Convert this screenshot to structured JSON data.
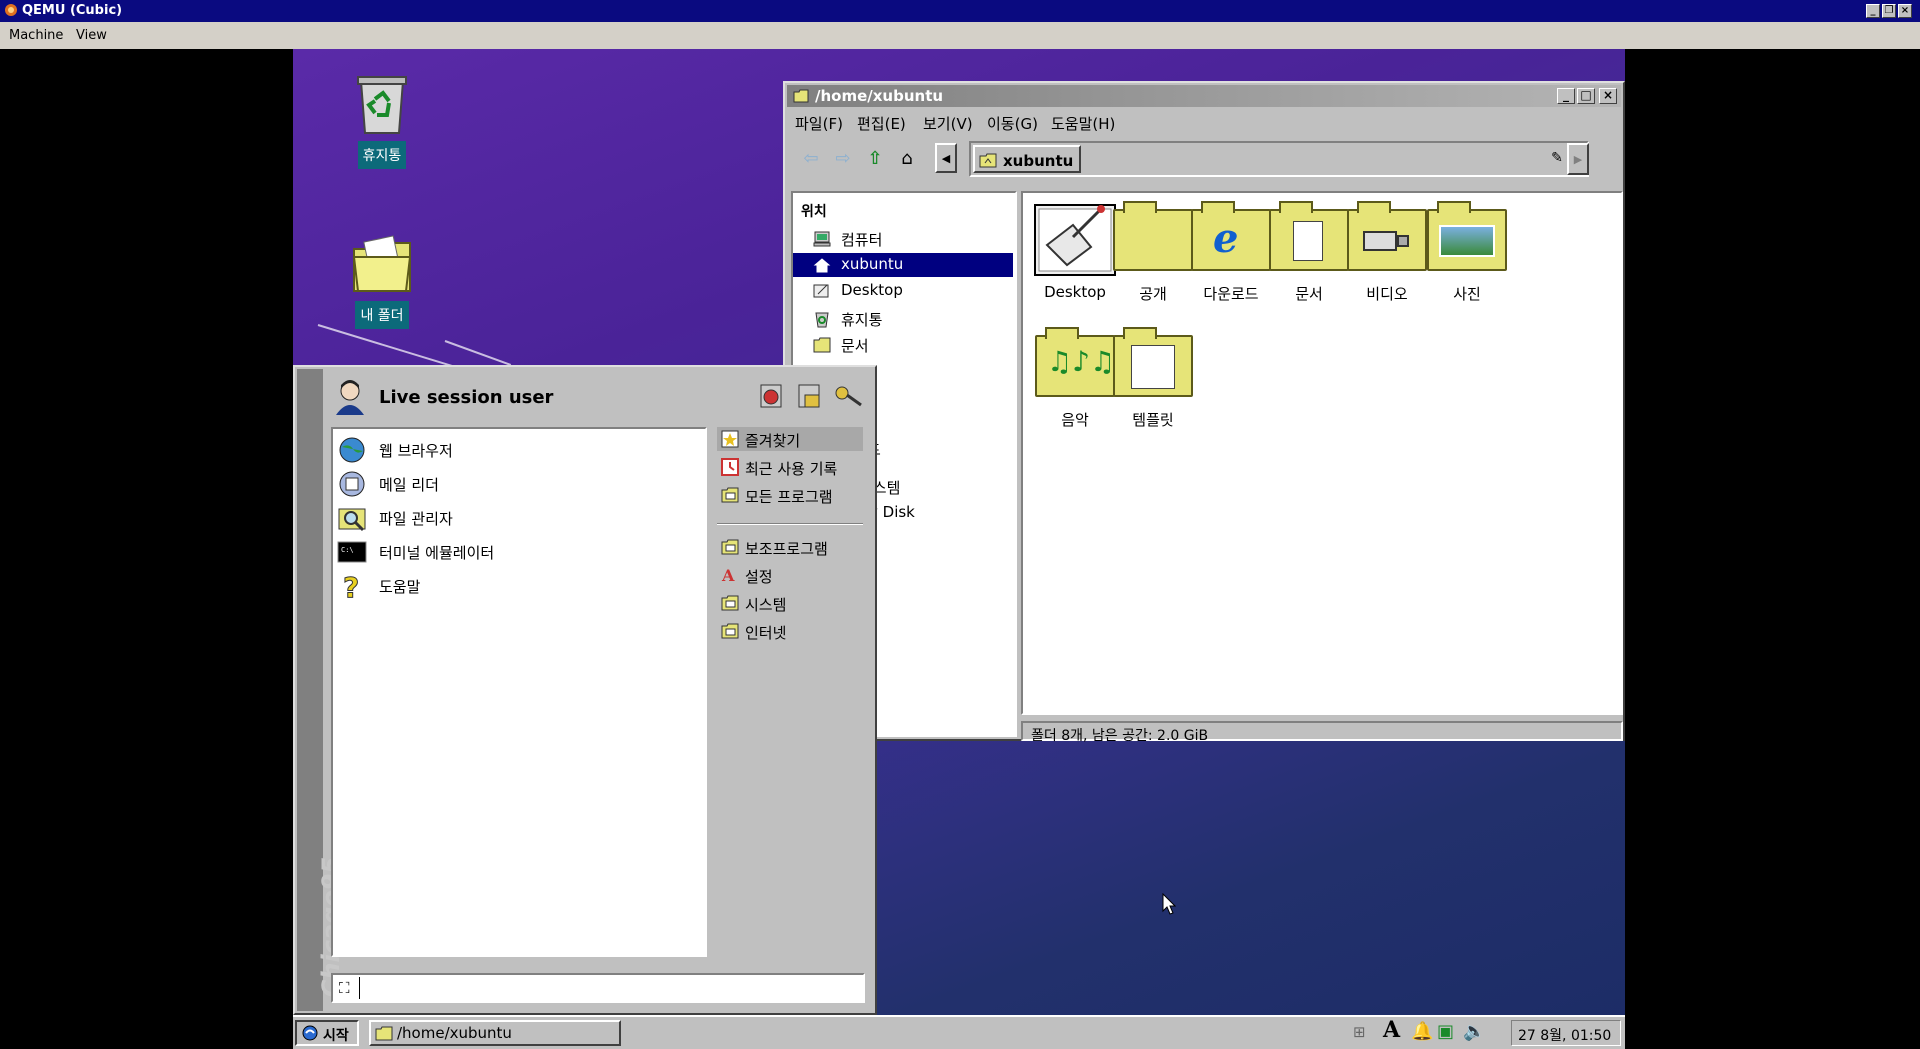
{
  "host": {
    "title": "QEMU (Cubic)",
    "menu": [
      "Machine",
      "View"
    ]
  },
  "desktop": {
    "icons": [
      {
        "label": "휴지통",
        "icon": "recycle-bin-icon"
      },
      {
        "label": "내 폴더",
        "icon": "home-folder-icon"
      }
    ]
  },
  "file_manager": {
    "title": "/home/xubuntu",
    "menu": [
      "파일(F)",
      "편집(E)",
      "보기(V)",
      "이동(G)",
      "도움말(H)"
    ],
    "path": "xubuntu",
    "sidebar_header": "위치",
    "sidebar": [
      {
        "label": "컴퓨터",
        "icon": "computer-icon"
      },
      {
        "label": "xubuntu",
        "icon": "home-icon",
        "selected": true
      },
      {
        "label": "Desktop",
        "icon": "desktop-icon"
      },
      {
        "label": "휴지통",
        "icon": "trash-icon"
      },
      {
        "label": "문서",
        "icon": "documents-icon"
      }
    ],
    "sidebar_partial": [
      "드",
      "시스템",
      "y Disk"
    ],
    "items": [
      {
        "label": "Desktop",
        "icon": "desktop-folder-icon"
      },
      {
        "label": "공개",
        "icon": "public-folder-icon"
      },
      {
        "label": "다운로드",
        "icon": "downloads-folder-icon"
      },
      {
        "label": "문서",
        "icon": "documents-folder-icon"
      },
      {
        "label": "비디오",
        "icon": "videos-folder-icon"
      },
      {
        "label": "사진",
        "icon": "pictures-folder-icon"
      },
      {
        "label": "음악",
        "icon": "music-folder-icon"
      },
      {
        "label": "템플릿",
        "icon": "templates-folder-icon"
      }
    ],
    "status": "폴더 8개, 남은 공간: 2.0 GiB"
  },
  "start_menu": {
    "user": "Live session user",
    "brand": "Chicago95",
    "favorites": [
      {
        "label": "웹 브라우저",
        "icon": "web-browser-icon"
      },
      {
        "label": "메일 리더",
        "icon": "mail-reader-icon"
      },
      {
        "label": "파일 관리자",
        "icon": "file-manager-icon"
      },
      {
        "label": "터미널 에뮬레이터",
        "icon": "terminal-icon"
      },
      {
        "label": "도움말",
        "icon": "help-icon"
      }
    ],
    "categories": [
      {
        "label": "즐겨찾기",
        "icon": "favorites-icon",
        "selected": true
      },
      {
        "label": "최근 사용 기록",
        "icon": "recent-icon"
      },
      {
        "label": "모든 프로그램",
        "icon": "all-programs-icon"
      },
      {
        "label": "보조프로그램",
        "icon": "accessories-icon"
      },
      {
        "label": "설정",
        "icon": "settings-icon"
      },
      {
        "label": "시스템",
        "icon": "system-icon"
      },
      {
        "label": "인터넷",
        "icon": "internet-icon"
      }
    ],
    "search_placeholder": ""
  },
  "taskbar": {
    "start_label": "시작",
    "window_button": "/home/xubuntu",
    "clock": "27 8월, 01:50"
  }
}
